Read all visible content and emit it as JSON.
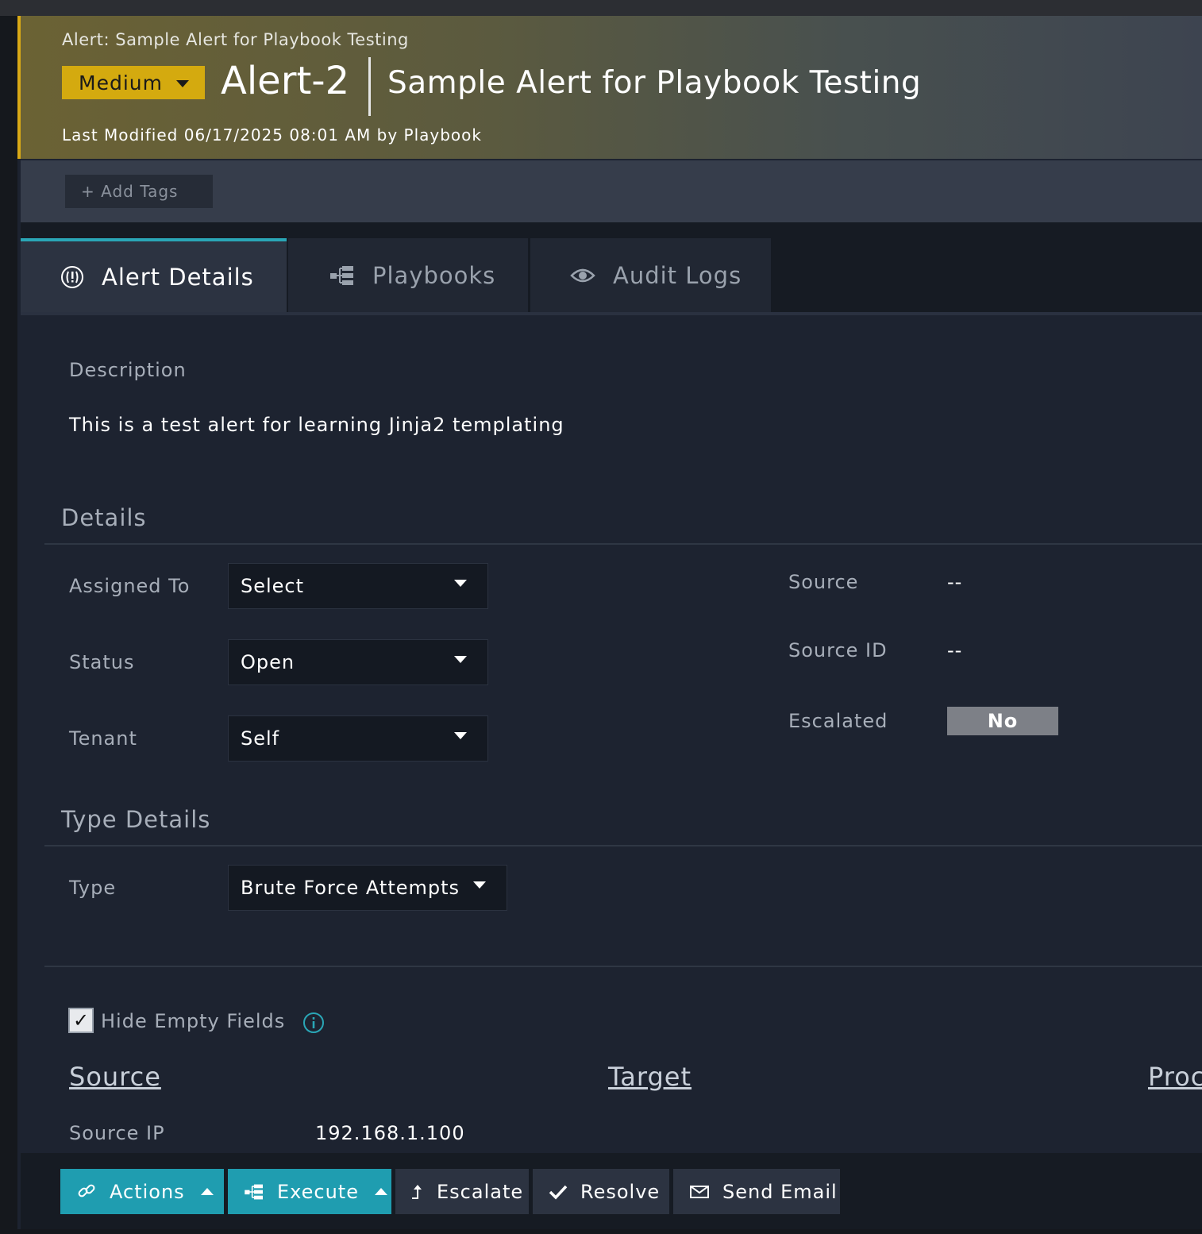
{
  "header": {
    "breadcrumb": "Alert: Sample Alert for Playbook Testing",
    "severity": "Medium",
    "alert_id": "Alert-2",
    "alert_name": "Sample Alert for Playbook Testing",
    "last_modified": "Last Modified 06/17/2025 08:01 AM by Playbook",
    "severity_color": "#d4aa0f"
  },
  "tags": {
    "add_label": "+ Add Tags"
  },
  "tabs": [
    {
      "label": "Alert Details",
      "icon": "alert-circle-icon",
      "active": true
    },
    {
      "label": "Playbooks",
      "icon": "playbook-icon",
      "active": false
    },
    {
      "label": "Audit Logs",
      "icon": "eye-icon",
      "active": false
    }
  ],
  "description": {
    "heading": "Description",
    "text": "This is a test alert for learning Jinja2 templating"
  },
  "details": {
    "heading": "Details",
    "assigned_to": {
      "label": "Assigned To",
      "value": "Select"
    },
    "status": {
      "label": "Status",
      "value": "Open"
    },
    "tenant": {
      "label": "Tenant",
      "value": "Self"
    },
    "source": {
      "label": "Source",
      "value": "--"
    },
    "source_id": {
      "label": "Source ID",
      "value": "--"
    },
    "escalated": {
      "label": "Escalated",
      "value": "No"
    }
  },
  "type_details": {
    "heading": "Type Details",
    "type": {
      "label": "Type",
      "value": "Brute Force Attempts"
    }
  },
  "fields": {
    "hide_empty_label": "Hide Empty Fields",
    "hide_empty_checked": true,
    "col_source": "Source",
    "col_target": "Target",
    "col_proc": "Proc",
    "source_ip_label": "Source IP",
    "source_ip_value": "192.168.1.100"
  },
  "actions": {
    "actions_label": "Actions",
    "execute_label": "Execute",
    "escalate_label": "Escalate",
    "resolve_label": "Resolve",
    "send_email_label": "Send Email",
    "accent_color": "#1f9db0"
  }
}
